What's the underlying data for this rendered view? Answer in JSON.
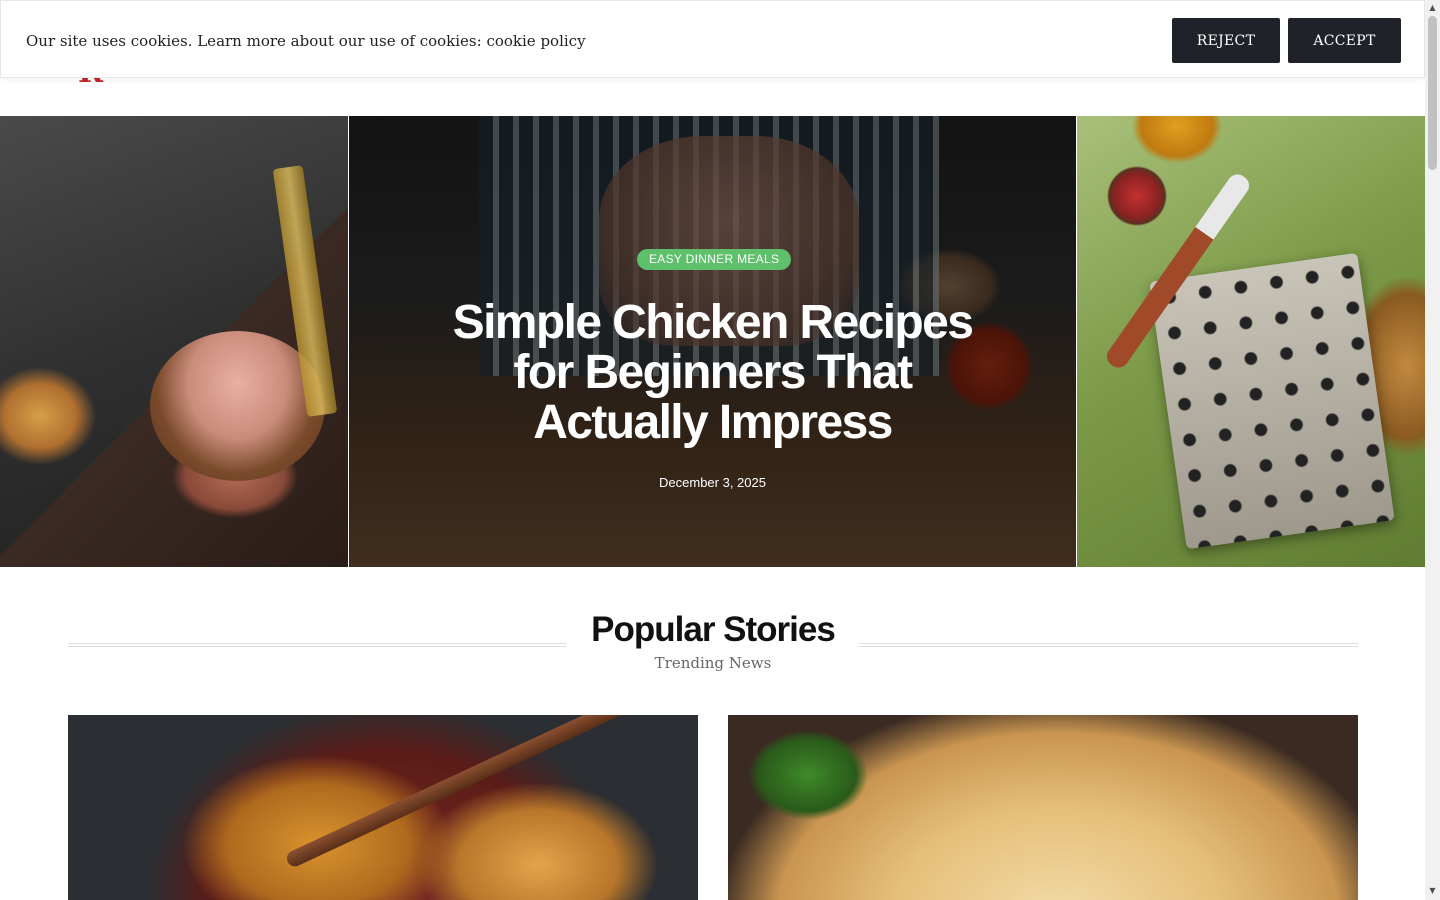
{
  "header": {
    "logo_text": "R",
    "brand_color": "#c0282d"
  },
  "cookie_bar": {
    "message": "Our site uses cookies. Learn more about our use of cookies:",
    "policy_link": "cookie policy",
    "reject_label": "REJECT",
    "accept_label": "ACCEPT",
    "button_color": "#1f2329"
  },
  "hero": {
    "category": "EASY DINNER MEALS",
    "category_color": "#5ec06a",
    "title": "Simple Chicken Recipes for Beginners That Actually Impress",
    "date": "December 3, 2025"
  },
  "popular": {
    "title": "Popular Stories",
    "subtitle": "Trending News"
  },
  "scrollbar": {
    "up_icon": "▲",
    "down_icon": "▼"
  }
}
